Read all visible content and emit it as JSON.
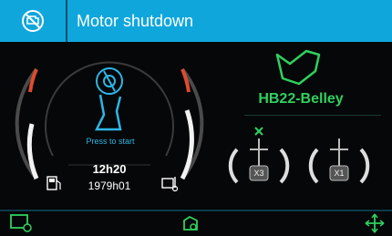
{
  "header": {
    "title": "Motor shutdown",
    "icon": "engine-off-icon"
  },
  "gauge": {
    "press_label": "Press to start",
    "time": "12h20",
    "hours": "1979h01",
    "left_icon": "fuel-icon",
    "right_icon": "temperature-icon"
  },
  "profile": {
    "name": "HB22-Belley",
    "icon": "map-area-icon"
  },
  "axles": [
    {
      "label": "X3",
      "icon": "axle-icon"
    },
    {
      "label": "X1",
      "icon": "axle-icon"
    }
  ],
  "bottom": {
    "left_icon": "vehicle-screen-icon",
    "center_icon": "engine-icon",
    "right_icon": "move-icon"
  },
  "colors": {
    "accent": "#0fa6dc",
    "green": "#2fd15e",
    "red": "#e04a2f"
  }
}
